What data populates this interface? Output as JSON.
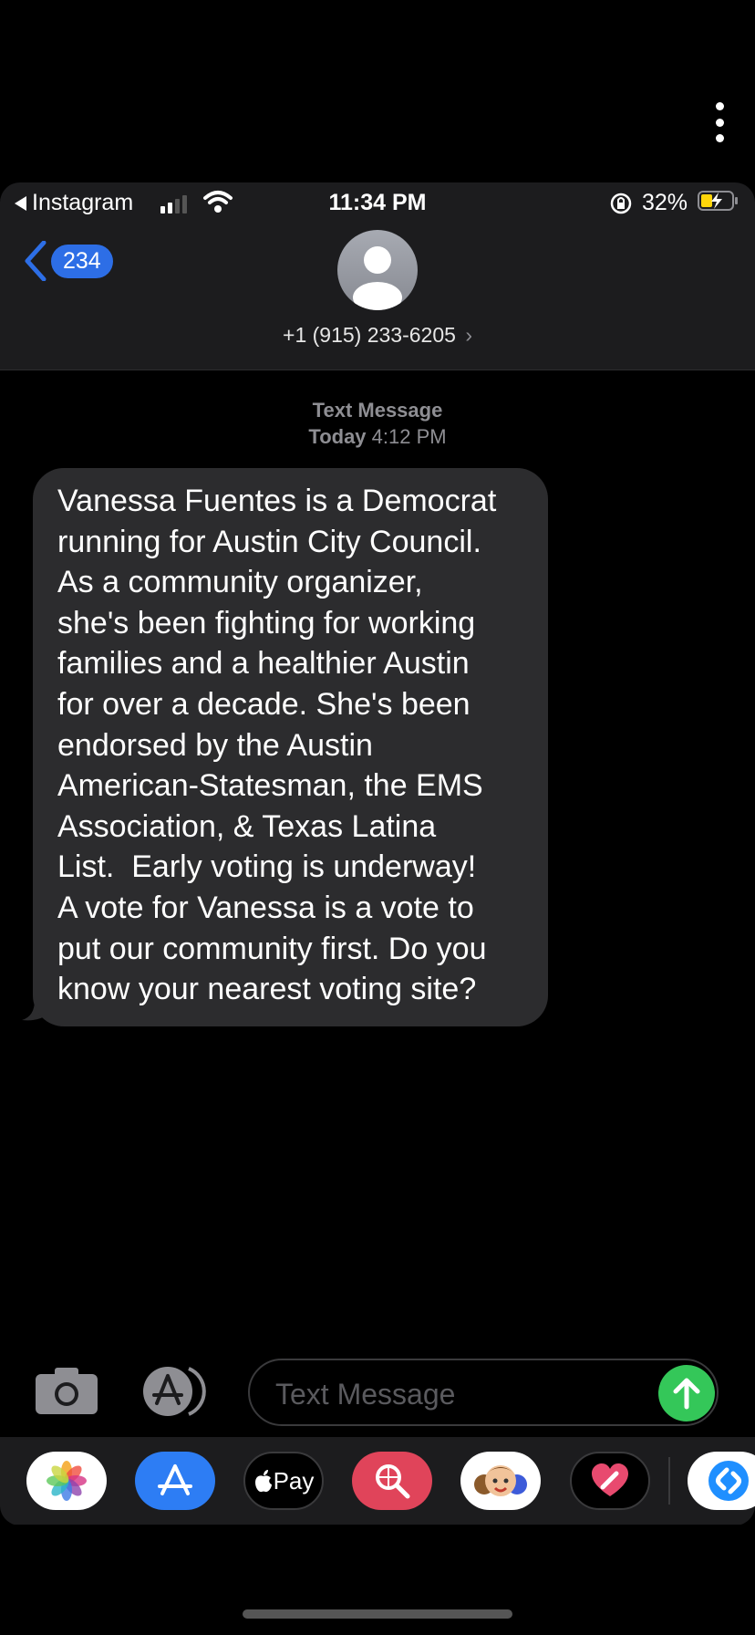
{
  "status_bar": {
    "back_app": "Instagram",
    "time": "11:34 PM",
    "battery": "32%"
  },
  "nav": {
    "back_badge": "234",
    "contact": "+1 (915) 233-6205",
    "chevron": "›"
  },
  "thread": {
    "service": "Text Message",
    "day": "Today",
    "time": "4:12 PM",
    "message": "Vanessa Fuentes is a Democrat\nrunning for Austin City Council.\nAs a community organizer,\nshe's been fighting for working\nfamilies and a healthier Austin\nfor over a decade. She's been\nendorsed by the Austin\nAmerican-Statesman, the EMS\nAssociation, & Texas Latina\nList.  Early voting is underway!\nA vote for Vanessa is a vote to\nput our community first. Do you\nknow your nearest voting site?"
  },
  "compose": {
    "placeholder": "Text Message"
  },
  "app_drawer": {
    "apple_pay_label": "Pay",
    "apps": [
      "photos-icon",
      "app-store-icon",
      "apple-pay-icon",
      "web-search-icon",
      "memoji-icon",
      "heart-sticker-icon",
      "shazam-icon"
    ]
  },
  "colors": {
    "accent": "#2d6ee6",
    "bubble": "#2c2c2e",
    "send": "#34c759"
  }
}
